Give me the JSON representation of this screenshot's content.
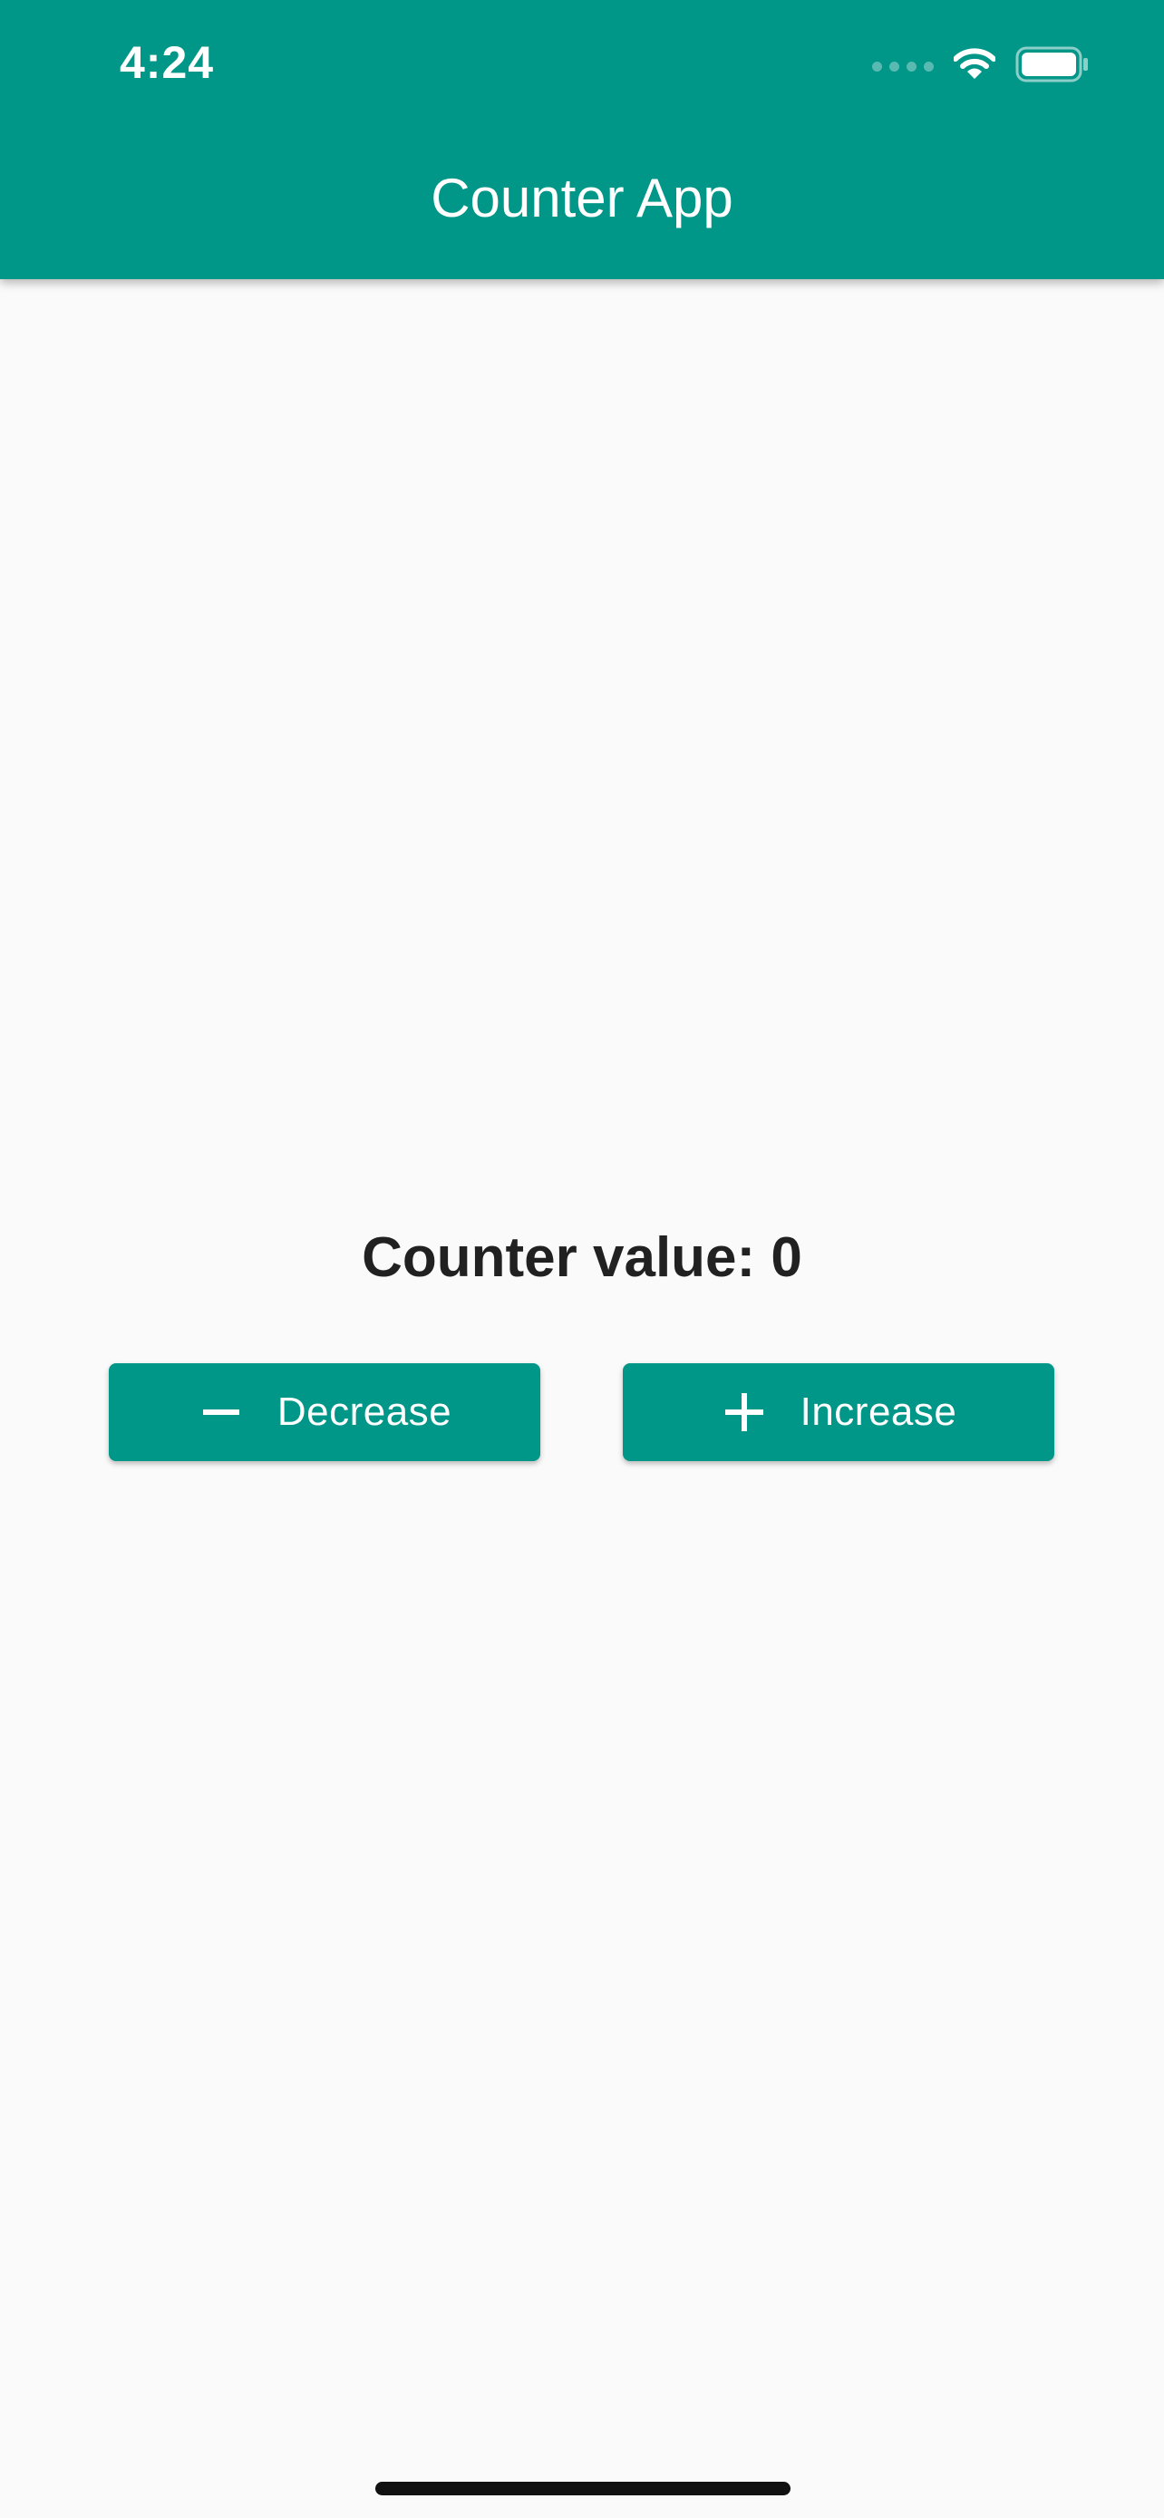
{
  "status_bar": {
    "time": "4:24",
    "wifi_icon": "wifi-icon",
    "battery_icon": "battery-icon",
    "signal_icon": "cellular-signal-icon"
  },
  "app_bar": {
    "title": "Counter App",
    "color": "#009688"
  },
  "main": {
    "counter_label": "Counter value: 0",
    "decrease_button": {
      "label": "Decrease",
      "icon": "minus-icon"
    },
    "increase_button": {
      "label": "Increase",
      "icon": "plus-icon"
    }
  },
  "colors": {
    "accent": "#009688",
    "background": "#fafafa",
    "text": "#212121"
  }
}
